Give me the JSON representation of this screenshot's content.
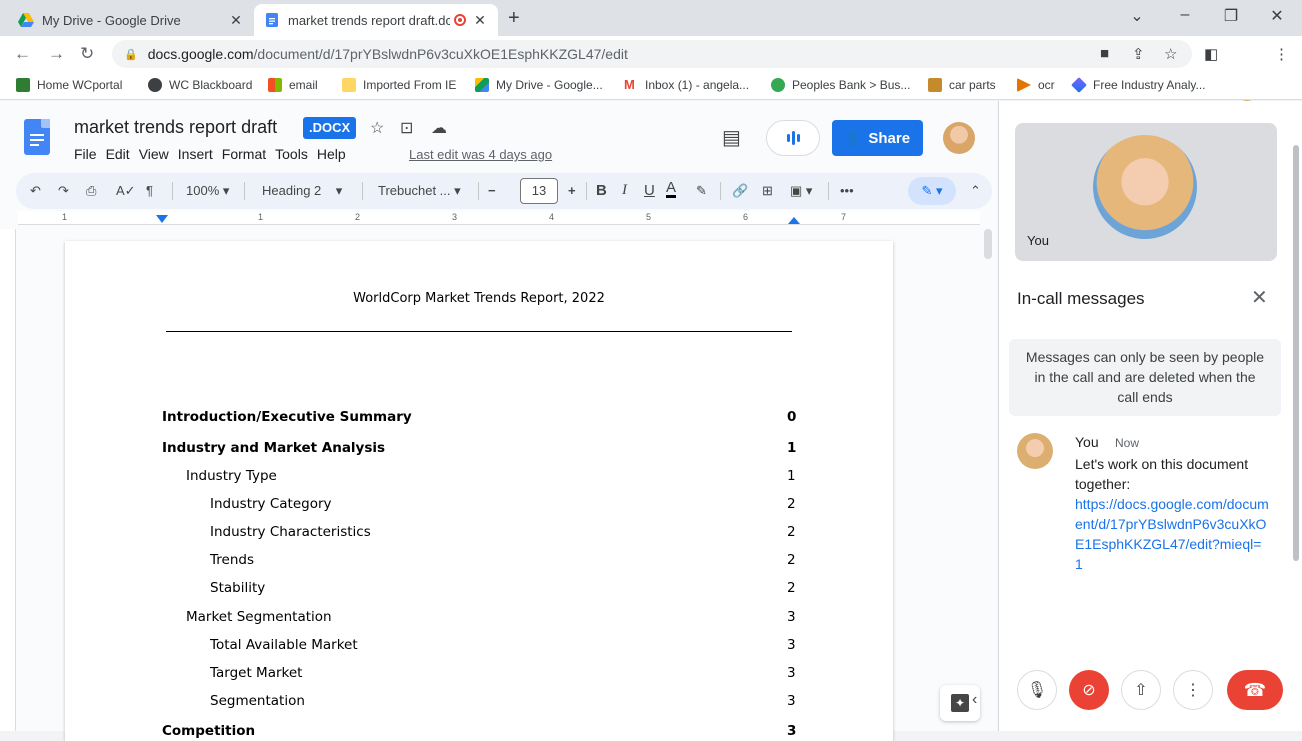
{
  "browser": {
    "tabs": [
      {
        "title": "My Drive - Google Drive",
        "icon": "google-drive-icon"
      },
      {
        "title": "market trends report draft.dc",
        "icon": "google-docs-icon",
        "recording": true
      }
    ],
    "url_host": "docs.google.com",
    "url_path": "/document/d/17prYBslwdnP6v3cuXkOE1EsphKKZGL47/edit",
    "bookmarks": [
      {
        "label": "Home WCportal"
      },
      {
        "label": "WC Blackboard"
      },
      {
        "label": "email"
      },
      {
        "label": "Imported From IE"
      },
      {
        "label": "My Drive - Google..."
      },
      {
        "label": "Inbox (1) - angela..."
      },
      {
        "label": "Peoples Bank > Bus..."
      },
      {
        "label": "car parts"
      },
      {
        "label": "ocr"
      },
      {
        "label": "Free Industry Analy..."
      }
    ]
  },
  "docs": {
    "title": "market trends report draft",
    "badge": ".DOCX",
    "menu": [
      "File",
      "Edit",
      "View",
      "Insert",
      "Format",
      "Tools",
      "Help"
    ],
    "last_edit": "Last edit was 4 days ago",
    "share_label": "Share",
    "toolbar": {
      "zoom": "100%",
      "style": "Heading 2",
      "font": "Trebuchet ...",
      "font_size": "13",
      "more": "•••"
    },
    "ruler_numbers": [
      "1",
      "1",
      "2",
      "3",
      "4",
      "5",
      "6",
      "7"
    ]
  },
  "document": {
    "heading": "WorldCorp Market Trends Report, 2022",
    "toc": [
      {
        "text": "Introduction/Executive Summary",
        "page": "0",
        "level": 0
      },
      {
        "text": "Industry and Market Analysis",
        "page": "1",
        "level": 0
      },
      {
        "text": "Industry Type",
        "page": "1",
        "level": 1
      },
      {
        "text": "Industry Category",
        "page": "2",
        "level": 2
      },
      {
        "text": "Industry Characteristics",
        "page": "2",
        "level": 2
      },
      {
        "text": "Trends",
        "page": "2",
        "level": 2
      },
      {
        "text": "Stability",
        "page": "2",
        "level": 2
      },
      {
        "text": "Market Segmentation",
        "page": "3",
        "level": 1
      },
      {
        "text": "Total Available Market",
        "page": "3",
        "level": 2
      },
      {
        "text": "Target Market",
        "page": "3",
        "level": 2
      },
      {
        "text": "Segmentation",
        "page": "3",
        "level": 2
      },
      {
        "text": "Competition",
        "page": "3",
        "level": 0
      }
    ]
  },
  "call_panel": {
    "self_label": "You",
    "title": "In-call messages",
    "notice": "Messages can only be seen by people in the call and are deleted when the call ends",
    "message": {
      "sender": "You",
      "time": "Now",
      "text": "Let's work on this document together:",
      "link": "https://docs.google.com/document/d/17prYBslwdnP6v3cuXkOE1EsphKKZGL47/edit?mieql=1"
    }
  },
  "colors": {
    "accent": "#1a73e8",
    "danger": "#ea4335"
  }
}
